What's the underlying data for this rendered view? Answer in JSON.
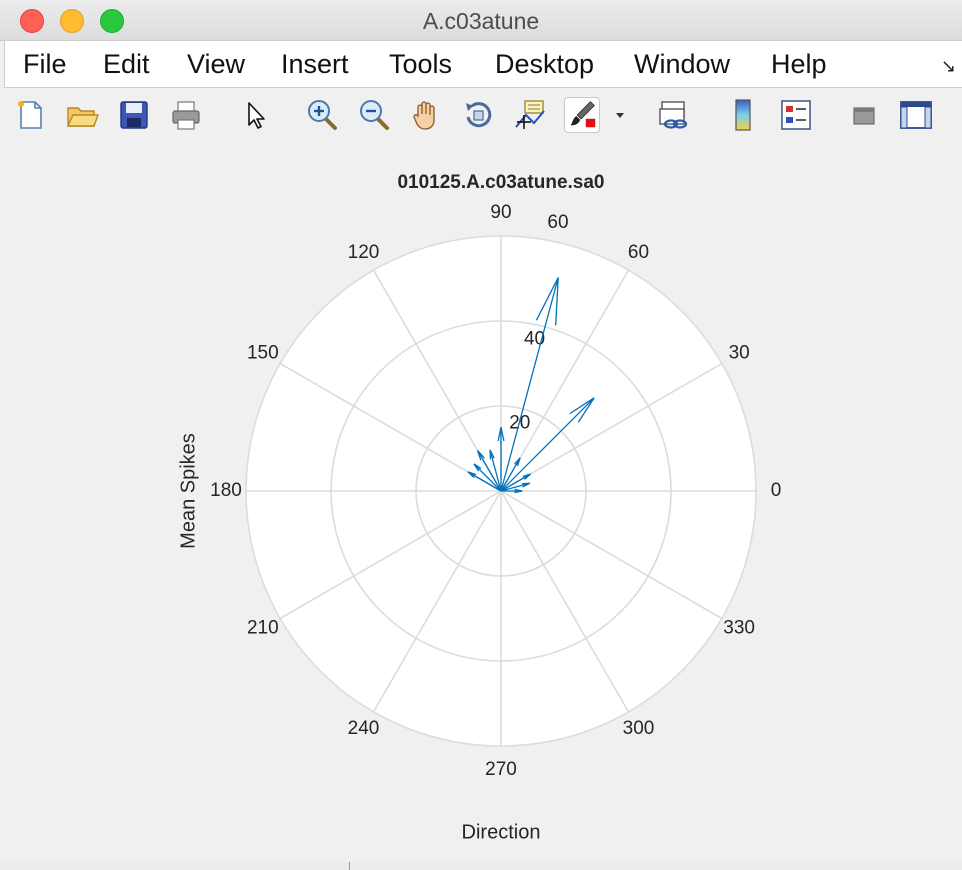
{
  "window": {
    "title": "A.c03atune"
  },
  "menu": {
    "items": [
      "File",
      "Edit",
      "View",
      "Insert",
      "Tools",
      "Desktop",
      "Window",
      "Help"
    ]
  },
  "toolbar": {
    "icons": [
      "new-figure-icon",
      "open-file-icon",
      "save-icon",
      "print-icon",
      "pointer-icon",
      "zoom-in-icon",
      "zoom-out-icon",
      "pan-hand-icon",
      "rotate-3d-icon",
      "data-cursor-icon",
      "brush-icon",
      "dropdown-arrow-icon",
      "link-plot-icon",
      "colorbar-icon",
      "legend-icon",
      "hide-plot-tools-icon",
      "show-plot-tools-icon"
    ]
  },
  "colors": {
    "arrow": "#0072bd",
    "grid": "#dcdcdc",
    "plot_bg": "#ffffff",
    "axes_text": "#262626"
  },
  "chart_data": {
    "type": "compass",
    "title": "010125.A.c03atune.sa0",
    "xlabel": "Direction",
    "ylabel": "Mean Spikes",
    "angle_ticks": [
      "0",
      "30",
      "60",
      "90",
      "120",
      "150",
      "180",
      "210",
      "240",
      "270",
      "300",
      "330"
    ],
    "extra_tick_label": "60",
    "radius_ticks": [
      "20",
      "40"
    ],
    "rmax": 60,
    "series": [
      {
        "vectors": [
          {
            "angle": 75,
            "r": 52
          },
          {
            "angle": 45,
            "r": 31
          },
          {
            "angle": 90,
            "r": 15
          },
          {
            "angle": 105,
            "r": 10
          },
          {
            "angle": 120,
            "r": 11
          },
          {
            "angle": 135,
            "r": 9
          },
          {
            "angle": 150,
            "r": 9
          },
          {
            "angle": 60,
            "r": 9
          },
          {
            "angle": 30,
            "r": 8
          },
          {
            "angle": 15,
            "r": 7
          },
          {
            "angle": 0,
            "r": 5
          }
        ]
      }
    ]
  }
}
